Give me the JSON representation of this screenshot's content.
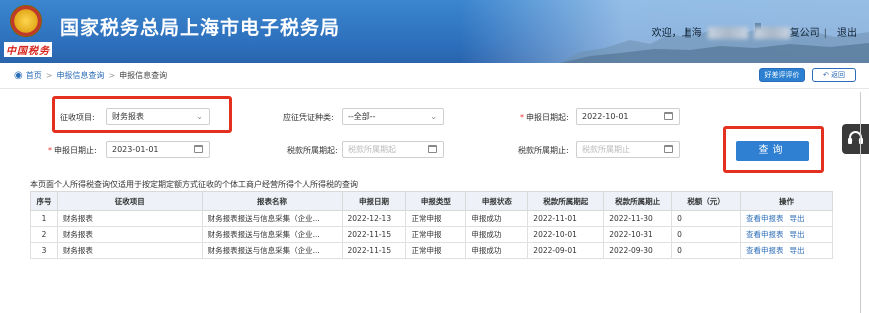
{
  "header": {
    "emblem_script": "中国税务",
    "title": "国家税务总局上海市电子税务局",
    "greeting": "欢迎，上海",
    "company": "复公司",
    "logout": "退出"
  },
  "breadcrumb": {
    "home": "首页",
    "level1": "申报信息查询",
    "level2": "申报信息查询"
  },
  "toolbar": {
    "rate_label": "好差评评价",
    "back_label": "返回"
  },
  "form": {
    "collect_item_label": "征收项目:",
    "collect_item_value": "财务报表",
    "voucher_type_label": "应征凭证种类:",
    "voucher_type_value": "--全部--",
    "declare_date_start_label": "申报日期起:",
    "declare_date_start_value": "2022-10-01",
    "declare_date_end_label": "申报日期止:",
    "declare_date_end_value": "2023-01-01",
    "tax_period_start_label": "税款所属期起:",
    "tax_period_start_placeholder": "税款所属期起",
    "tax_period_end_label": "税款所属期止:",
    "tax_period_end_placeholder": "税款所属期止",
    "query_label": "查询"
  },
  "note": "本页面个人所得税查询仅适用于按定期定额方式征收的个体工商户经营所得个人所得税的查询",
  "table": {
    "headers": [
      "序号",
      "征收项目",
      "报表名称",
      "申报日期",
      "申报类型",
      "申报状态",
      "税款所属期起",
      "税款所属期止",
      "税额（元）",
      "操作"
    ],
    "rows": [
      {
        "no": "1",
        "item": "财务报表",
        "report": "财务报表报送与信息采集（企业...",
        "date": "2022-12-13",
        "type": "正常申报",
        "status": "申报成功",
        "start": "2022-11-01",
        "end": "2022-11-30",
        "amount": "0",
        "view": "查看申报表",
        "export": "导出"
      },
      {
        "no": "2",
        "item": "财务报表",
        "report": "财务报表报送与信息采集（企业...",
        "date": "2022-11-15",
        "type": "正常申报",
        "status": "申报成功",
        "start": "2022-10-01",
        "end": "2022-10-31",
        "amount": "0",
        "view": "查看申报表",
        "export": "导出"
      },
      {
        "no": "3",
        "item": "财务报表",
        "report": "财务报表报送与信息采集（企业...",
        "date": "2022-11-15",
        "type": "正常申报",
        "status": "申报成功",
        "start": "2022-09-01",
        "end": "2022-09-30",
        "amount": "0",
        "view": "查看申报表",
        "export": "导出"
      }
    ]
  },
  "colors": {
    "header_blue": "#2d6fbc",
    "link_blue": "#2b6cb8",
    "highlight_red": "#e3301f",
    "query_button": "#2f7fd3"
  },
  "icons": {
    "location": "location-pin-icon",
    "calendar": "calendar-icon",
    "dropdown": "chevron-down-icon",
    "back": "back-arrow-icon",
    "headset": "headset-icon"
  }
}
